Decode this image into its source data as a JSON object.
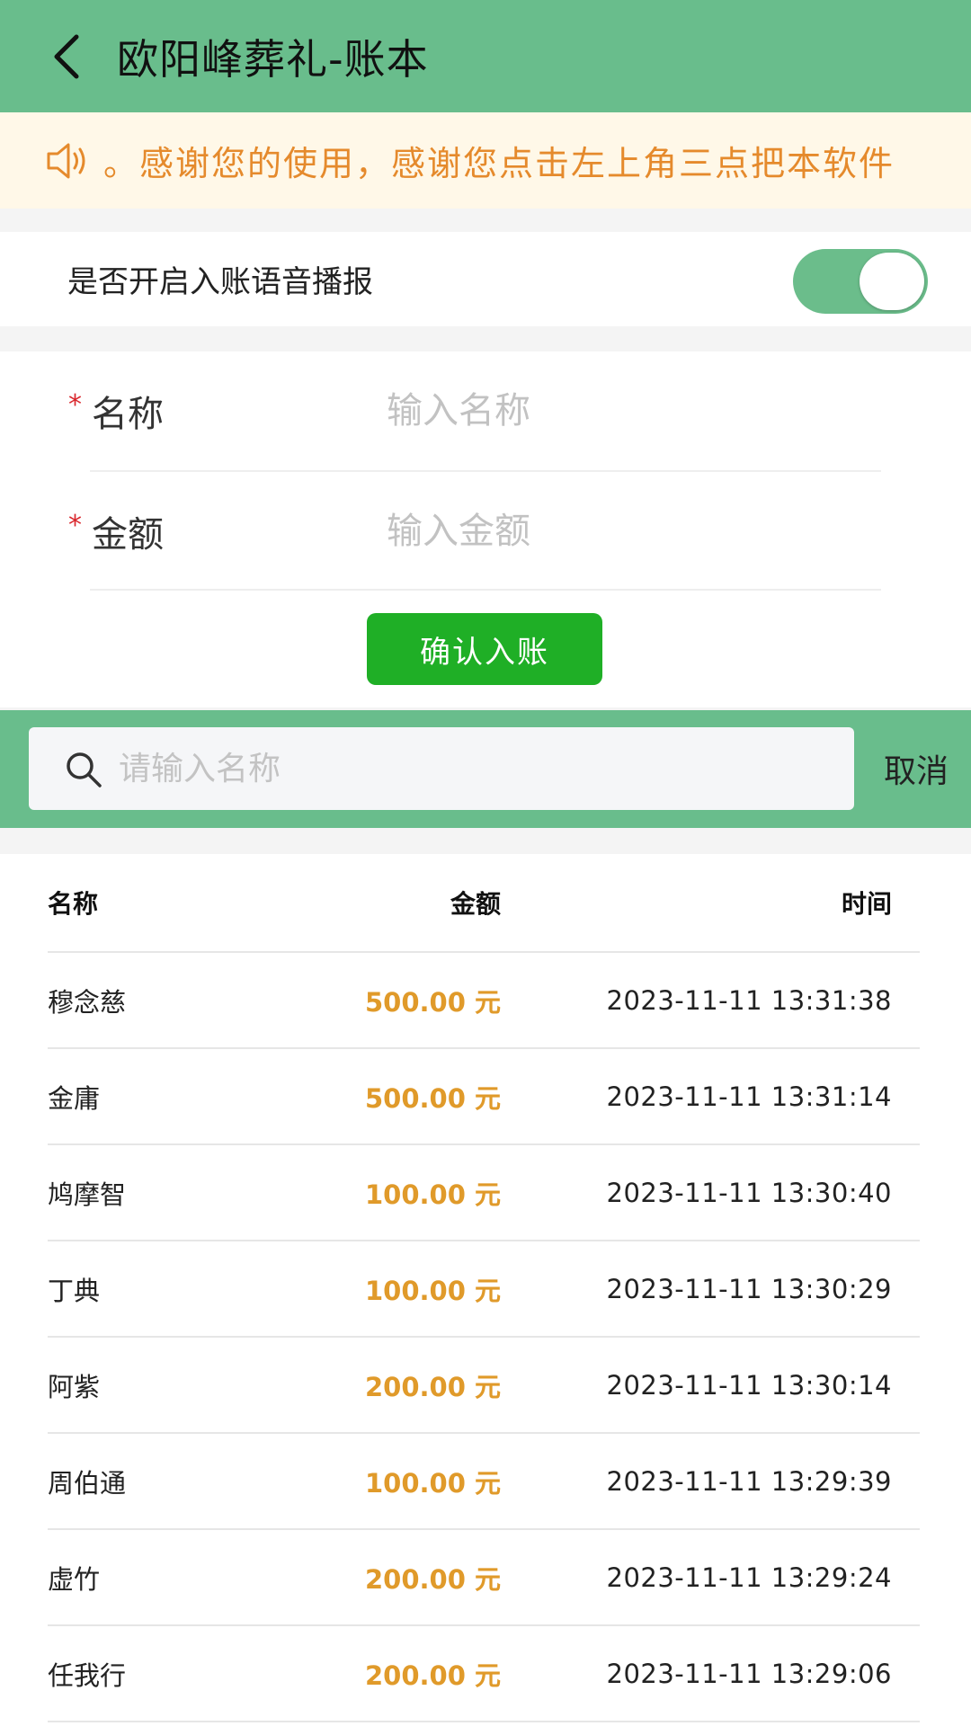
{
  "header": {
    "title": "欧阳峰葬礼-账本",
    "background": "#69bd8c"
  },
  "notice": {
    "icon": "speaker-icon",
    "text": "。感谢您的使用，感谢您点击左上角三点把本软件"
  },
  "voice": {
    "label": "是否开启入账语音播报",
    "enabled": true
  },
  "form": {
    "name_label": "名称",
    "name_placeholder": "输入名称",
    "amount_label": "金额",
    "amount_placeholder": "输入金额",
    "required_mark": "*",
    "confirm_label": "确认入账",
    "confirm_color": "#1faf26"
  },
  "search": {
    "placeholder": "请输入名称",
    "cancel_label": "取消"
  },
  "table": {
    "columns": [
      "名称",
      "金额",
      "时间"
    ],
    "rows": [
      {
        "name": "穆念慈",
        "amount": "500.00 元",
        "time": "2023-11-11 13:31:38"
      },
      {
        "name": "金庸",
        "amount": "500.00 元",
        "time": "2023-11-11 13:31:14"
      },
      {
        "name": "鸠摩智",
        "amount": "100.00 元",
        "time": "2023-11-11 13:30:40"
      },
      {
        "name": "丁典",
        "amount": "100.00 元",
        "time": "2023-11-11 13:30:29"
      },
      {
        "name": "阿紫",
        "amount": "200.00 元",
        "time": "2023-11-11 13:30:14"
      },
      {
        "name": "周伯通",
        "amount": "100.00 元",
        "time": "2023-11-11 13:29:39"
      },
      {
        "name": "虚竹",
        "amount": "200.00 元",
        "time": "2023-11-11 13:29:24"
      },
      {
        "name": "任我行",
        "amount": "200.00 元",
        "time": "2023-11-11 13:29:06"
      }
    ],
    "amount_color": "#e09a2a"
  }
}
